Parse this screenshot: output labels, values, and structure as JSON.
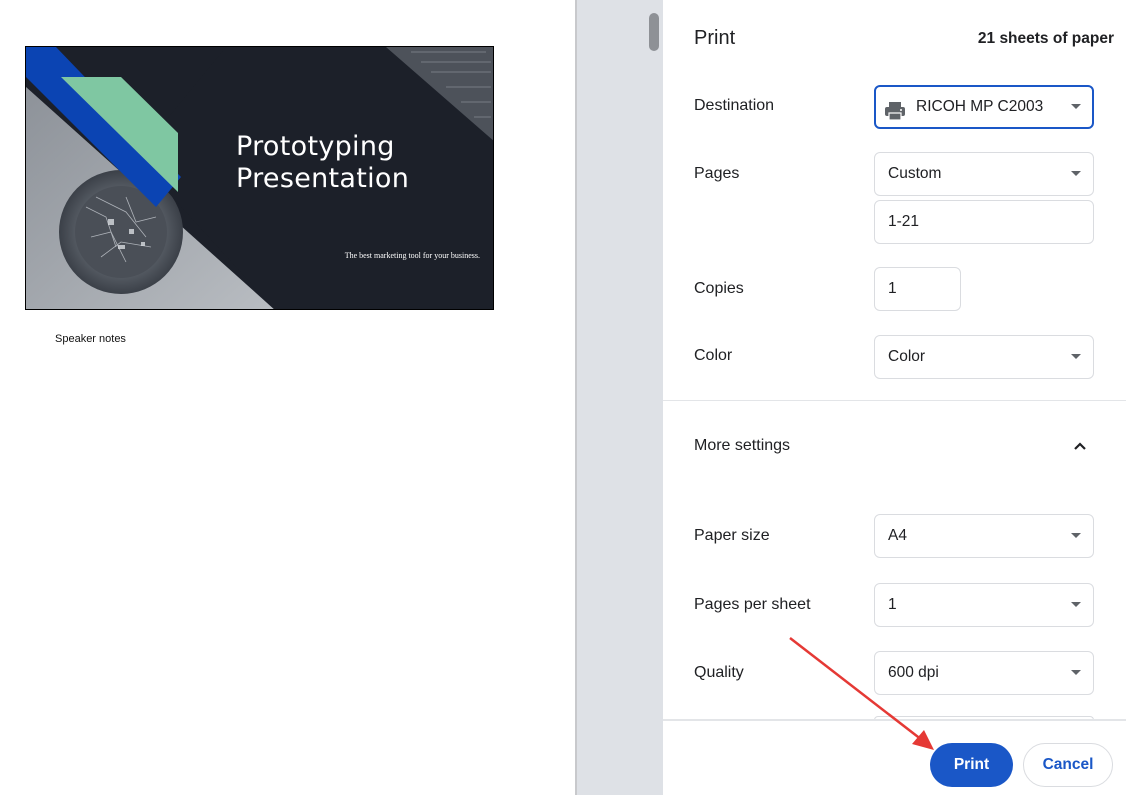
{
  "preview": {
    "slide": {
      "title_line1": "Prototyping",
      "title_line2": "Presentation",
      "subtitle": "The best marketing tool for your business."
    },
    "speaker_notes_label": "Speaker notes"
  },
  "print_panel": {
    "title": "Print",
    "sheet_count": "21 sheets of paper",
    "destination": {
      "label": "Destination",
      "value": "RICOH MP C2003",
      "icon": "printer-icon"
    },
    "pages": {
      "label": "Pages",
      "value": "Custom",
      "range": "1-21"
    },
    "copies": {
      "label": "Copies",
      "value": "1"
    },
    "color": {
      "label": "Color",
      "value": "Color"
    },
    "more_settings": {
      "label": "More settings",
      "icon": "chevron-up-icon"
    },
    "paper_size": {
      "label": "Paper size",
      "value": "A4"
    },
    "pages_per_sheet": {
      "label": "Pages per sheet",
      "value": "1"
    },
    "quality": {
      "label": "Quality",
      "value": "600 dpi"
    },
    "buttons": {
      "print": "Print",
      "cancel": "Cancel"
    }
  },
  "colors": {
    "accent_blue": "#1a57c7",
    "slide_background": "#1c2029",
    "slide_blue": "#0b44b3",
    "slide_green": "#7fc7a2",
    "annotation_arrow": "#e53935"
  }
}
